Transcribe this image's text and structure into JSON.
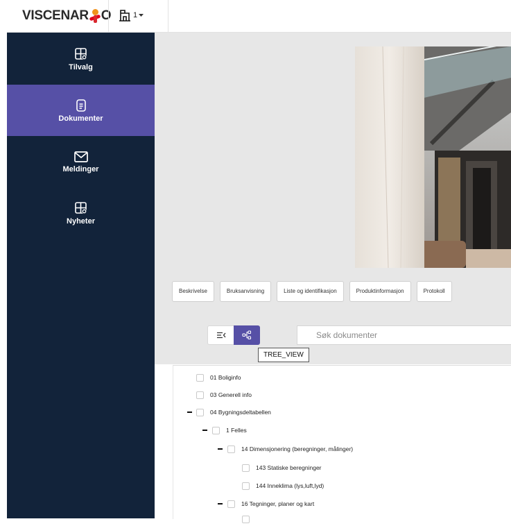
{
  "header": {
    "logo_text_pre": "VISCENAR",
    "logo_text_post": "O",
    "building_label": "1",
    "building_icon": "building-icon",
    "colors": {
      "logo_orange": "#f0931c",
      "logo_red": "#e2001a"
    }
  },
  "sidebar": {
    "background": "#12233a",
    "active_color": "#5650a6",
    "items": [
      {
        "label": "Tilvalg",
        "icon": "grid-gear-icon",
        "active": false
      },
      {
        "label": "Dokumenter",
        "icon": "document-icon",
        "active": true
      },
      {
        "label": "Meldinger",
        "icon": "envelope-icon",
        "active": false
      },
      {
        "label": "Nyheter",
        "icon": "grid-gear-icon",
        "active": false
      }
    ]
  },
  "document_tabs": [
    "Beskrivelse",
    "Bruksanvisning",
    "Liste og identifikasjon",
    "Produktinformasjon",
    "Protokoll"
  ],
  "view_toggle": {
    "list_icon": "list-collapse-icon",
    "tree_icon": "tree-view-icon",
    "tooltip": "TREE_VIEW"
  },
  "search": {
    "placeholder": "Søk dokumenter",
    "value": ""
  },
  "tree": [
    {
      "label": "01 Boliginfo",
      "level": 0,
      "expanded": false
    },
    {
      "label": "03 Generell info",
      "level": 0,
      "expanded": false
    },
    {
      "label": "04 Bygningsdeltabellen",
      "level": 0,
      "expanded": true
    },
    {
      "label": "1 Felles",
      "level": 1,
      "expanded": true
    },
    {
      "label": "14 Dimensjonering (beregninger, målinger)",
      "level": 2,
      "expanded": true
    },
    {
      "label": "143 Statiske beregninger",
      "level": 3,
      "expanded": false
    },
    {
      "label": "144 Inneklima (lys,luft,lyd)",
      "level": 3,
      "expanded": false
    },
    {
      "label": "16 Tegninger, planer og kart",
      "level": 2,
      "expanded": true
    }
  ]
}
